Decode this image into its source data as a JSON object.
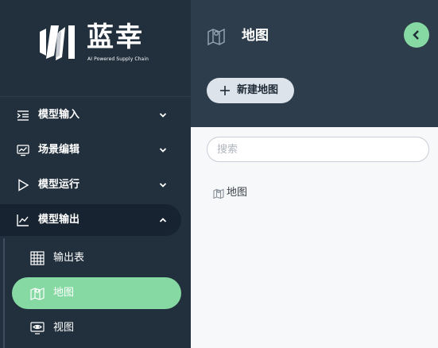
{
  "brand": {
    "name": "蓝幸",
    "tagline": "AI Powered Supply Chain",
    "accent_color": "#86d9a2"
  },
  "sidebar": {
    "items": [
      {
        "label": "模型输入",
        "icon": "indent-list-icon",
        "state": "collapsed"
      },
      {
        "label": "场景编辑",
        "icon": "monitor-chart-icon",
        "state": "collapsed"
      },
      {
        "label": "模型运行",
        "icon": "play-icon",
        "state": "collapsed"
      },
      {
        "label": "模型输出",
        "icon": "line-chart-icon",
        "state": "expanded"
      }
    ],
    "subitems": [
      {
        "label": "输出表",
        "icon": "table-grid-icon"
      },
      {
        "label": "地图",
        "icon": "map-icon",
        "active": true
      },
      {
        "label": "视图",
        "icon": "eye-monitor-icon"
      }
    ]
  },
  "header": {
    "title": "地图",
    "new_button_label": "新建地图"
  },
  "search": {
    "placeholder": "搜索",
    "value": ""
  },
  "maps": [
    {
      "label": "地图"
    }
  ]
}
